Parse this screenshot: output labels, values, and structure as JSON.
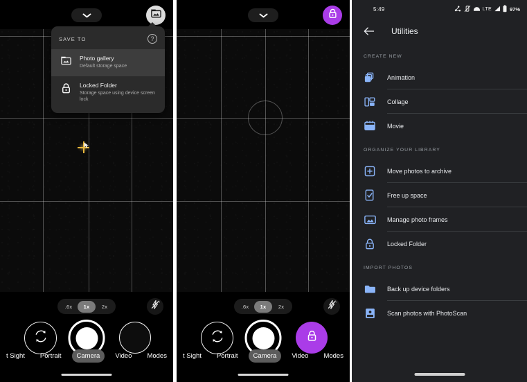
{
  "panel_camera_1": {
    "name": "Google Camera - Save to menu open",
    "topbar": {
      "chevron_icon": "chevron-down-icon",
      "gallery_button_icon": "photo-gallery-icon"
    },
    "save_menu": {
      "title": "SAVE TO",
      "help_icon": "help-circle-icon",
      "options": [
        {
          "icon": "photo-gallery-icon",
          "title": "Photo gallery",
          "subtitle": "Default storage space",
          "selected": true
        },
        {
          "icon": "lock-icon",
          "title": "Locked Folder",
          "subtitle": "Storage space using device screen lock",
          "selected": false
        }
      ]
    },
    "zoom_options": [
      ".6x",
      "1x",
      "2x"
    ],
    "zoom_selected": "1x",
    "flash_icon": "flash-auto-off-icon",
    "controls": {
      "flip_camera_icon": "flip-camera-icon",
      "shutter_label": "shutter-button",
      "thumbnail_label": "last-photo-thumbnail"
    },
    "modes": [
      "t Sight",
      "Portrait",
      "Camera",
      "Video",
      "Modes"
    ],
    "mode_selected": "Camera"
  },
  "panel_camera_2": {
    "name": "Google Camera - Locked Folder mode",
    "topbar": {
      "chevron_icon": "chevron-down-icon",
      "locked_button_icon": "lock-icon"
    },
    "zoom_options": [
      ".6x",
      "1x",
      "2x"
    ],
    "zoom_selected": "1x",
    "flash_icon": "flash-auto-off-icon",
    "controls": {
      "flip_camera_icon": "flip-camera-icon",
      "shutter_label": "shutter-button",
      "thumbnail_icon": "lock-icon"
    },
    "modes": [
      "t Sight",
      "Portrait",
      "Camera",
      "Video",
      "Modes"
    ],
    "mode_selected": "Camera"
  },
  "panel_utilities": {
    "statusbar": {
      "time": "5:49",
      "icons": [
        "bluetooth-share-icon",
        "vibrate-off-icon",
        "vpn-icon"
      ],
      "network": "LTE",
      "signal_icon": "signal-bar-icon",
      "battery_icon": "battery-icon",
      "battery_percent": "97%"
    },
    "appbar": {
      "back_icon": "back-arrow-icon",
      "title": "Utilities"
    },
    "sections": [
      {
        "label": "CREATE NEW",
        "items": [
          {
            "icon": "animation-icon",
            "label": "Animation"
          },
          {
            "icon": "collage-icon",
            "label": "Collage"
          },
          {
            "icon": "movie-icon",
            "label": "Movie"
          }
        ]
      },
      {
        "label": "ORGANIZE YOUR LIBRARY",
        "items": [
          {
            "icon": "archive-icon",
            "label": "Move photos to archive"
          },
          {
            "icon": "free-up-space-icon",
            "label": "Free up space"
          },
          {
            "icon": "photo-frame-icon",
            "label": "Manage photo frames"
          },
          {
            "icon": "lock-icon",
            "label": "Locked Folder"
          }
        ]
      },
      {
        "label": "IMPORT PHOTOS",
        "items": [
          {
            "icon": "folder-icon",
            "label": "Back up device folders"
          },
          {
            "icon": "photoscan-icon",
            "label": "Scan photos with PhotoScan"
          }
        ]
      }
    ]
  },
  "colors": {
    "accent_purple": "#aa3ce8",
    "icon_blue": "#8ab4f8",
    "bg_dark": "#202124",
    "cursor_gold": "#e8b73c"
  }
}
